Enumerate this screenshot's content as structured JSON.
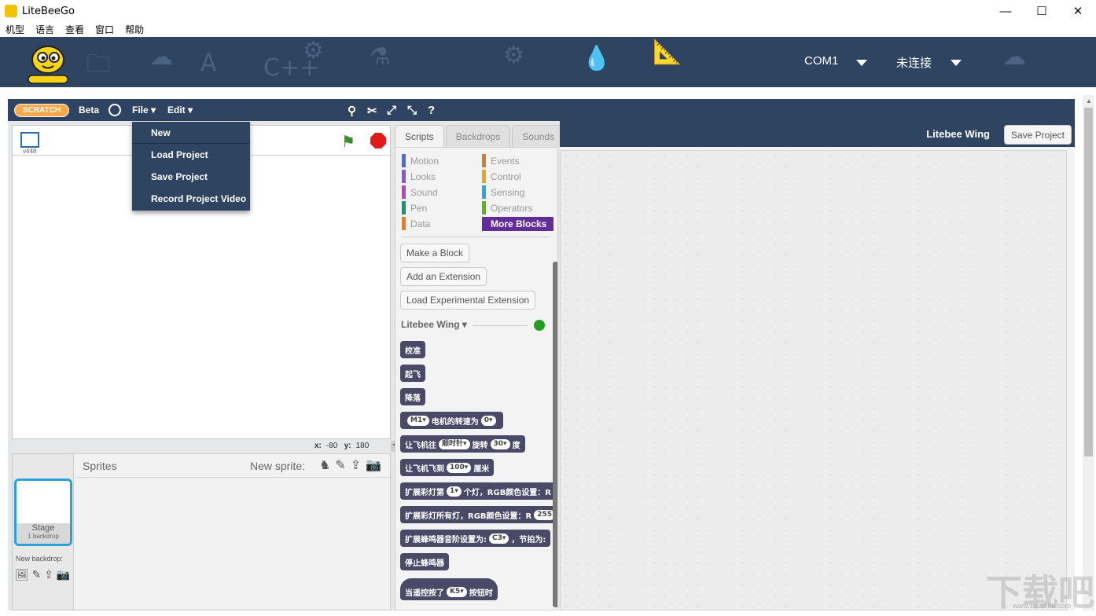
{
  "window": {
    "title": "LiteBeeGo",
    "controls": [
      "—",
      "☐",
      "✕"
    ]
  },
  "menubar": [
    "机型",
    "语言",
    "查看",
    "窗口",
    "帮助"
  ],
  "banner": {
    "port": "COM1",
    "status": "未连接"
  },
  "topbar": {
    "logo_text": "SCRATCH",
    "beta": "Beta",
    "file": "File ▾",
    "edit": "Edit ▾",
    "help": "?"
  },
  "file_menu": [
    "New",
    "Load Project",
    "Save Project",
    "Record Project Video"
  ],
  "stage": {
    "version": "v448",
    "x_label": "x:",
    "x_value": "-80",
    "y_label": "y:",
    "y_value": "180"
  },
  "sprites": {
    "title": "Sprites",
    "new_sprite": "New sprite:",
    "stage_name": "Stage",
    "stage_count": "1 backdrop",
    "new_backdrop": "New backdrop:"
  },
  "tabs": [
    "Scripts",
    "Backdrops",
    "Sounds"
  ],
  "categories": {
    "left": [
      {
        "label": "Motion",
        "color": "#4a6cd4"
      },
      {
        "label": "Looks",
        "color": "#8a55d7"
      },
      {
        "label": "Sound",
        "color": "#bb42c3"
      },
      {
        "label": "Pen",
        "color": "#0e9a6c"
      },
      {
        "label": "Data",
        "color": "#ee7d16"
      }
    ],
    "right": [
      {
        "label": "Events",
        "color": "#c88330"
      },
      {
        "label": "Control",
        "color": "#e1a91a"
      },
      {
        "label": "Sensing",
        "color": "#2ca5e2"
      },
      {
        "label": "Operators",
        "color": "#5cb712"
      }
    ],
    "active": "More Blocks"
  },
  "palette_buttons": [
    "Make a Block",
    "Add an Extension",
    "Load Experimental Extension"
  ],
  "extension": {
    "name": "Litebee Wing ▾"
  },
  "blocks": [
    {
      "text": "校准"
    },
    {
      "text": "起飞"
    },
    {
      "text": "降落"
    },
    {
      "pre": "",
      "p1": "M1▾",
      "mid": "电机的转速为",
      "p2": "0▾",
      "post": ""
    },
    {
      "pre": "让飞机往",
      "p1": "顺时针▾",
      "mid": "旋转",
      "p2": "30▾",
      "post": "度"
    },
    {
      "pre": "让飞机飞到",
      "p1": "100▾",
      "mid": "厘米",
      "p2": "",
      "post": ""
    },
    {
      "pre": "扩展彩灯第",
      "p1": "1▾",
      "mid": "个灯，RGB颜色设置：R",
      "p2": "",
      "post": ""
    },
    {
      "pre": "扩展彩灯所有灯，RGB颜色设置：R",
      "p1": "255",
      "mid": "",
      "p2": "",
      "post": ""
    },
    {
      "pre": "扩展蜂鸣器音阶设置为:",
      "p1": "C3▾",
      "mid": "，节拍为:",
      "p2": "",
      "post": ""
    },
    {
      "text": "停止蜂鸣器"
    },
    {
      "pre": "当遥控按了",
      "p1": "K5▾",
      "mid": "按钮时",
      "p2": "",
      "post": ""
    }
  ],
  "scripts_header": {
    "title": "Litebee Wing",
    "save": "Save Project"
  },
  "watermark": {
    "text": "下载吧",
    "sub": "www.xiazaiba.com"
  }
}
